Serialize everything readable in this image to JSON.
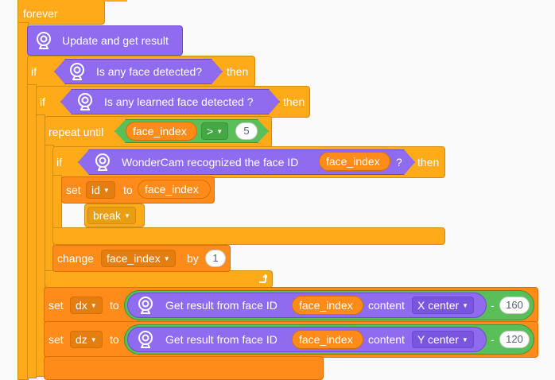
{
  "blocks": {
    "forever": "forever",
    "update": "Update and get result",
    "if1": {
      "kw": "if",
      "cond": "Is any face detected?",
      "then": "then"
    },
    "if2": {
      "kw": "if",
      "cond": "Is any learned face detected ?",
      "then": "then"
    },
    "repeat": {
      "kw": "repeat until",
      "var": "face_index",
      "op": ">",
      "val": "5"
    },
    "if3": {
      "kw": "if",
      "cond": "WonderCam recognized the face ID",
      "var": "face_index",
      "q": "?",
      "then": "then"
    },
    "set_id": {
      "kw": "set",
      "var": "id",
      "to": "to",
      "val": "face_index"
    },
    "brk": "break",
    "change": {
      "kw": "change",
      "var": "face_index",
      "by": "by",
      "val": "1"
    },
    "set_dx": {
      "kw": "set",
      "var": "dx",
      "to": "to",
      "text": "Get result from face ID",
      "fid": "face_index",
      "content": "content",
      "field": "X center",
      "minus": "-",
      "val": "160"
    },
    "set_dz": {
      "kw": "set",
      "var": "dz",
      "to": "to",
      "text": "Get result from face ID",
      "fid": "face_index",
      "content": "content",
      "field": "Y center",
      "minus": "-",
      "val": "120"
    }
  },
  "colors": {
    "control": "#FFAB19",
    "variable": "#FF8C1A",
    "extension": "#8F6BF0",
    "operator": "#59C059"
  },
  "icons": [
    "camera-icon",
    "dropdown-arrow-icon",
    "repeat-arrow-icon"
  ]
}
